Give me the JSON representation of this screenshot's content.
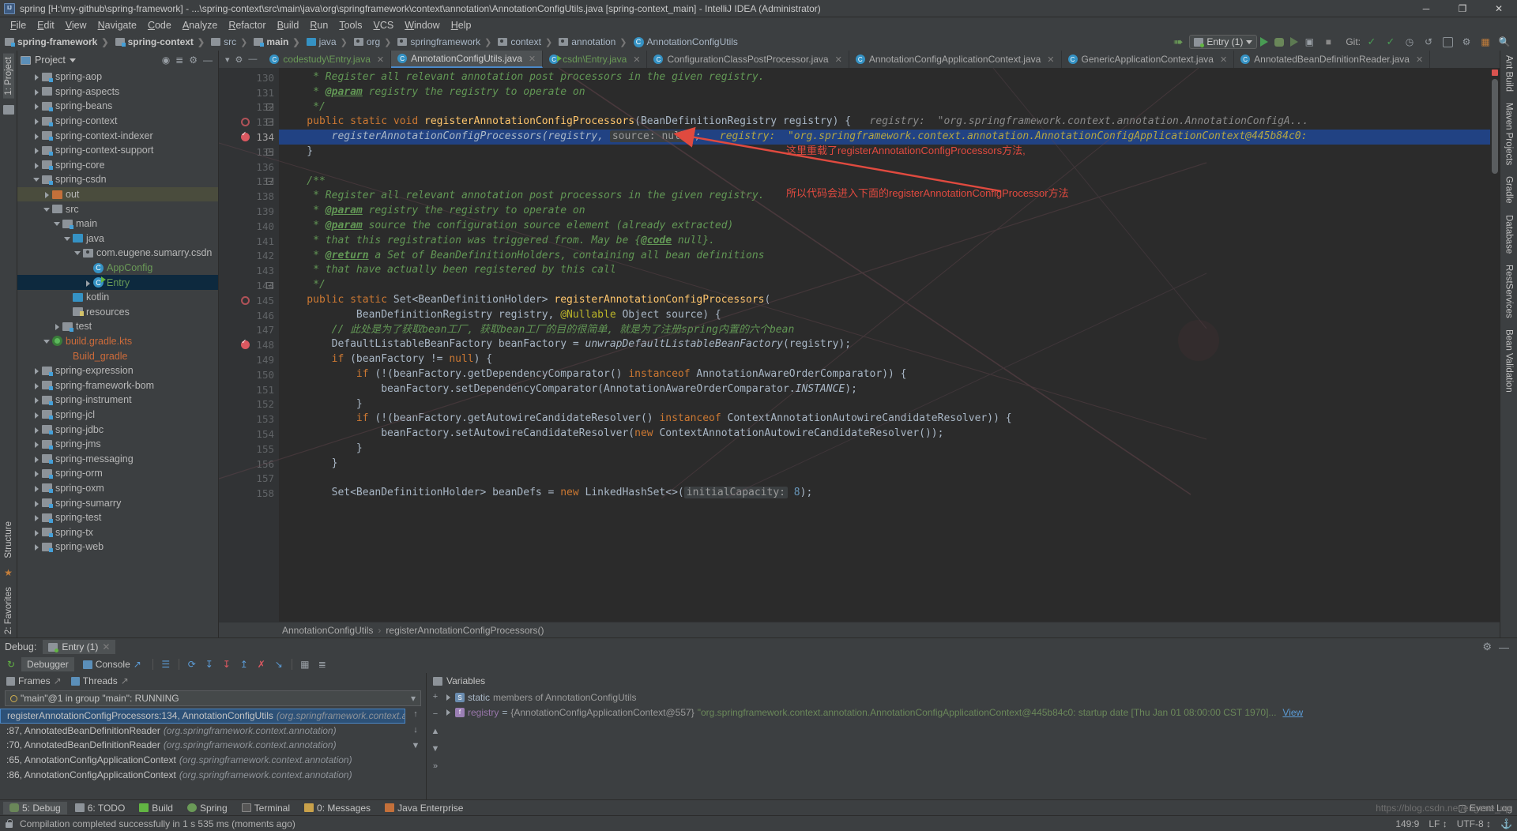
{
  "window": {
    "title": "spring [H:\\my-github\\spring-framework] - ...\\spring-context\\src\\main\\java\\org\\springframework\\context\\annotation\\AnnotationConfigUtils.java [spring-context_main] - IntelliJ IDEA (Administrator)",
    "minimize": "─",
    "maximize": "❐",
    "close": "✕"
  },
  "menu": [
    "File",
    "Edit",
    "View",
    "Navigate",
    "Code",
    "Analyze",
    "Refactor",
    "Build",
    "Run",
    "Tools",
    "VCS",
    "Window",
    "Help"
  ],
  "navbar": {
    "crumbs": [
      {
        "label": "spring-framework",
        "icon": "module-folder-icon",
        "bold": true
      },
      {
        "label": "spring-context",
        "icon": "module-folder-icon",
        "bold": true
      },
      {
        "label": "src",
        "icon": "folder-icon",
        "bold": false
      },
      {
        "label": "main",
        "icon": "module-folder-icon",
        "bold": true
      },
      {
        "label": "java",
        "icon": "source-folder-icon",
        "bold": false
      },
      {
        "label": "org",
        "icon": "package-icon",
        "bold": false
      },
      {
        "label": "springframework",
        "icon": "package-icon",
        "bold": false
      },
      {
        "label": "context",
        "icon": "package-icon",
        "bold": false
      },
      {
        "label": "annotation",
        "icon": "package-icon",
        "bold": false
      },
      {
        "label": "AnnotationConfigUtils",
        "icon": "class-icon",
        "bold": false
      }
    ],
    "run_config": "Entry (1)",
    "git_label": "Git:"
  },
  "project_panel": {
    "title": "Project",
    "tree": [
      {
        "label": "spring-aop",
        "indent": 1,
        "arrow": "right",
        "icon": "module",
        "color": "default"
      },
      {
        "label": "spring-aspects",
        "indent": 1,
        "arrow": "right",
        "icon": "plain",
        "color": "default"
      },
      {
        "label": "spring-beans",
        "indent": 1,
        "arrow": "right",
        "icon": "module",
        "color": "default"
      },
      {
        "label": "spring-context",
        "indent": 1,
        "arrow": "right",
        "icon": "module",
        "color": "default"
      },
      {
        "label": "spring-context-indexer",
        "indent": 1,
        "arrow": "right",
        "icon": "module",
        "color": "default"
      },
      {
        "label": "spring-context-support",
        "indent": 1,
        "arrow": "right",
        "icon": "module",
        "color": "default"
      },
      {
        "label": "spring-core",
        "indent": 1,
        "arrow": "right",
        "icon": "module",
        "color": "default"
      },
      {
        "label": "spring-csdn",
        "indent": 1,
        "arrow": "down",
        "icon": "module",
        "color": "default"
      },
      {
        "label": "out",
        "indent": 2,
        "arrow": "right",
        "icon": "orange",
        "color": "default",
        "row": "sel-green"
      },
      {
        "label": "src",
        "indent": 2,
        "arrow": "down",
        "icon": "plain",
        "color": "default"
      },
      {
        "label": "main",
        "indent": 3,
        "arrow": "down",
        "icon": "module",
        "color": "default"
      },
      {
        "label": "java",
        "indent": 4,
        "arrow": "down",
        "icon": "blue",
        "color": "default"
      },
      {
        "label": "com.eugene.sumarry.csdn",
        "indent": 5,
        "arrow": "down",
        "icon": "package",
        "color": "default"
      },
      {
        "label": "AppConfig",
        "indent": 6,
        "arrow": "none",
        "icon": "class",
        "color": "green"
      },
      {
        "label": "Entry",
        "indent": 6,
        "arrow": "right",
        "icon": "class-run",
        "color": "green",
        "row": "sel-blue"
      },
      {
        "label": "kotlin",
        "indent": 4,
        "arrow": "none",
        "icon": "blue",
        "color": "default"
      },
      {
        "label": "resources",
        "indent": 4,
        "arrow": "none",
        "icon": "res",
        "color": "default"
      },
      {
        "label": "test",
        "indent": 3,
        "arrow": "right",
        "icon": "module",
        "color": "default"
      },
      {
        "label": "build.gradle.kts",
        "indent": 2,
        "arrow": "down",
        "icon": "gradle",
        "color": "orange"
      },
      {
        "label": "Build_gradle",
        "indent": 4,
        "arrow": "none",
        "icon": "none",
        "color": "orange"
      },
      {
        "label": "spring-expression",
        "indent": 1,
        "arrow": "right",
        "icon": "module",
        "color": "default"
      },
      {
        "label": "spring-framework-bom",
        "indent": 1,
        "arrow": "right",
        "icon": "module",
        "color": "default"
      },
      {
        "label": "spring-instrument",
        "indent": 1,
        "arrow": "right",
        "icon": "module",
        "color": "default"
      },
      {
        "label": "spring-jcl",
        "indent": 1,
        "arrow": "right",
        "icon": "module",
        "color": "default"
      },
      {
        "label": "spring-jdbc",
        "indent": 1,
        "arrow": "right",
        "icon": "module",
        "color": "default"
      },
      {
        "label": "spring-jms",
        "indent": 1,
        "arrow": "right",
        "icon": "module",
        "color": "default"
      },
      {
        "label": "spring-messaging",
        "indent": 1,
        "arrow": "right",
        "icon": "module",
        "color": "default"
      },
      {
        "label": "spring-orm",
        "indent": 1,
        "arrow": "right",
        "icon": "module",
        "color": "default"
      },
      {
        "label": "spring-oxm",
        "indent": 1,
        "arrow": "right",
        "icon": "module",
        "color": "default"
      },
      {
        "label": "spring-sumarry",
        "indent": 1,
        "arrow": "right",
        "icon": "module",
        "color": "default"
      },
      {
        "label": "spring-test",
        "indent": 1,
        "arrow": "right",
        "icon": "module",
        "color": "default"
      },
      {
        "label": "spring-tx",
        "indent": 1,
        "arrow": "right",
        "icon": "module",
        "color": "default"
      },
      {
        "label": "spring-web",
        "indent": 1,
        "arrow": "right",
        "icon": "module",
        "color": "default"
      }
    ]
  },
  "left_strip": {
    "project_tab": "1: Project",
    "structure_tab": "Structure",
    "favorites_tab": "2: Favorites"
  },
  "right_strip": [
    "Ant Build",
    "Maven Projects",
    "Gradle",
    "Database",
    "RestServices",
    "Bean Validation"
  ],
  "editor_tabs": [
    {
      "label": "codestudy\\Entry.java",
      "icon": "class-icon",
      "active": false,
      "green": true
    },
    {
      "label": "AnnotationConfigUtils.java",
      "icon": "class-icon",
      "active": true,
      "green": false
    },
    {
      "label": "csdn\\Entry.java",
      "icon": "class-run-icon",
      "active": false,
      "green": true
    },
    {
      "label": "ConfigurationClassPostProcessor.java",
      "icon": "class-icon",
      "active": false,
      "green": false
    },
    {
      "label": "AnnotationConfigApplicationContext.java",
      "icon": "class-icon",
      "active": false,
      "green": false
    },
    {
      "label": "GenericApplicationContext.java",
      "icon": "class-icon",
      "active": false,
      "green": false
    },
    {
      "label": "AnnotatedBeanDefinitionReader.java",
      "icon": "class-icon",
      "active": false,
      "green": false
    }
  ],
  "code": {
    "first_line": 130,
    "current_line": 134,
    "lines": [
      {
        "n": 130,
        "html": "<span class='cm'>     * Register all relevant annotation post processors in the given registry.</span>"
      },
      {
        "n": 131,
        "html": "<span class='cm'>     * </span><span class='cm-tag'>@param</span><span class='cm'> registry the registry to operate on</span>"
      },
      {
        "n": 132,
        "html": "<span class='cm'>     */</span>",
        "fold": true
      },
      {
        "n": 133,
        "html": "<span class='kw'>    public static void </span><span class='fn'>registerAnnotationConfigProcessors</span><span class='plain'>(BeanDefinitionRegistry registry) {</span>",
        "fold": true,
        "bp": "ring",
        "hint": "registry:  \"org.springframework.context.annotation.AnnotationConfigA..."
      },
      {
        "n": 134,
        "html": "<span class='plain italicf'>        registerAnnotationConfigProcessors(registry, </span>",
        "hl": true,
        "bp": "check",
        "param_hint": "source: null",
        "tail": ");",
        "inline": "registry:  \"org.springframework.context.annotation.AnnotationConfigApplicationContext@445b84c0:"
      },
      {
        "n": 135,
        "html": "<span class='plain'>    }</span>",
        "fold": true
      },
      {
        "n": 136,
        "html": ""
      },
      {
        "n": 137,
        "html": "<span class='cm'>    /**</span>",
        "fold": true
      },
      {
        "n": 138,
        "html": "<span class='cm'>     * Register all relevant annotation post processors in the given registry.</span>"
      },
      {
        "n": 139,
        "html": "<span class='cm'>     * </span><span class='cm-tag'>@param</span><span class='cm'> registry the registry to operate on</span>"
      },
      {
        "n": 140,
        "html": "<span class='cm'>     * </span><span class='cm-tag'>@param</span><span class='cm'> source the configuration source element (already extracted)</span>"
      },
      {
        "n": 141,
        "html": "<span class='cm'>     * that this registration was triggered from. May be {</span><span class='cm-tag'>@code</span><span class='cm'> null}.</span>"
      },
      {
        "n": 142,
        "html": "<span class='cm'>     * </span><span class='cm-tag'>@return</span><span class='cm'> a Set of BeanDefinitionHolders, containing all bean definitions</span>"
      },
      {
        "n": 143,
        "html": "<span class='cm'>     * that have actually been registered by this call</span>"
      },
      {
        "n": 144,
        "html": "<span class='cm'>     */</span>",
        "fold": true
      },
      {
        "n": 145,
        "html": "<span class='kw'>    public static </span><span class='plain'>Set&lt;BeanDefinitionHolder&gt; </span><span class='fn'>registerAnnotationConfigProcessors</span><span class='plain'>(</span>",
        "bp": "ring"
      },
      {
        "n": 146,
        "html": "<span class='plain'>            BeanDefinitionRegistry registry, </span><span class='an'>@Nullable </span><span class='plain'>Object source) {</span>"
      },
      {
        "n": 147,
        "html": "<span class='cn-cmt'>        // 此处是为了获取bean工厂, 获取bean工厂的目的很简单, 就是为了注册spring内置的六个bean</span>"
      },
      {
        "n": 148,
        "html": "<span class='plain'>        DefaultListableBeanFactory beanFactory = </span><span class='plain italicf'>unwrapDefaultListableBeanFactory</span><span class='plain'>(registry);</span>",
        "bp": "check"
      },
      {
        "n": 149,
        "html": "<span class='kw'>        if </span><span class='plain'>(beanFactory != </span><span class='kw'>null</span><span class='plain'>) {</span>"
      },
      {
        "n": 150,
        "html": "<span class='kw'>            if </span><span class='plain'>(!(beanFactory.getDependencyComparator() </span><span class='kw'>instanceof </span><span class='plain'>AnnotationAwareOrderComparator)) {</span>"
      },
      {
        "n": 151,
        "html": "<span class='plain'>                beanFactory.setDependencyComparator(AnnotationAwareOrderComparator.</span><span class='plain italicf'>INSTANCE</span><span class='plain'>);</span>"
      },
      {
        "n": 152,
        "html": "<span class='plain'>            }</span>"
      },
      {
        "n": 153,
        "html": "<span class='kw'>            if </span><span class='plain'>(!(beanFactory.getAutowireCandidateResolver() </span><span class='kw'>instanceof </span><span class='plain'>ContextAnnotationAutowireCandidateResolver)) {</span>"
      },
      {
        "n": 154,
        "html": "<span class='plain'>                beanFactory.setAutowireCandidateResolver(</span><span class='kw'>new </span><span class='plain'>ContextAnnotationAutowireCandidateResolver());</span>"
      },
      {
        "n": 155,
        "html": "<span class='plain'>            }</span>"
      },
      {
        "n": 156,
        "html": "<span class='plain'>        }</span>"
      },
      {
        "n": 157,
        "html": ""
      },
      {
        "n": 158,
        "html": "<span class='plain'>        Set&lt;BeanDefinitionHolder&gt; beanDefs = </span><span class='kw'>new </span><span class='plain'>LinkedHashSet&lt;&gt;(</span><span class='hint'>initialCapacity:</span><span class='num'> 8</span><span class='plain'>);</span>"
      }
    ]
  },
  "annotation_note": {
    "line1": "这里重载了registerAnnotationConfigProcessors方法,",
    "line2": "所以代码会进入下面的registerAnnotationConfigProcessor方法",
    "color": "#e04a3f"
  },
  "breadcrumbs": {
    "class": "AnnotationConfigUtils",
    "method": "registerAnnotationConfigProcessors()",
    "sep": "›"
  },
  "debug_panel": {
    "label": "Debug:",
    "session_tab": "Entry (1)",
    "tabs": [
      {
        "label": "Debugger",
        "selected": true
      },
      {
        "label": "Console",
        "selected": false
      }
    ],
    "frames_header": {
      "frames": "Frames",
      "threads": "Threads"
    },
    "thread_selector": "\"main\"@1 in group \"main\": RUNNING",
    "frames": [
      {
        "method": "registerAnnotationConfigProcessors:134, AnnotationConfigUtils",
        "pkg": "(org.springframework.context.annotation)",
        "selected": true
      },
      {
        "method": "<init>:87, AnnotatedBeanDefinitionReader",
        "pkg": "(org.springframework.context.annotation)",
        "selected": false
      },
      {
        "method": "<init>:70, AnnotatedBeanDefinitionReader",
        "pkg": "(org.springframework.context.annotation)",
        "selected": false
      },
      {
        "method": "<init>:65, AnnotationConfigApplicationContext",
        "pkg": "(org.springframework.context.annotation)",
        "selected": false
      },
      {
        "method": "<init>:86, AnnotationConfigApplicationContext",
        "pkg": "(org.springframework.context.annotation)",
        "selected": false
      }
    ],
    "variables_header": "Variables",
    "variables": [
      {
        "kind": "static",
        "name": "static",
        "rest": "members of AnnotationConfigUtils",
        "expand": true
      },
      {
        "kind": "field",
        "name": "registry",
        "eq": "=",
        "type": "{AnnotationConfigApplicationContext@557}",
        "value": "\"org.springframework.context.annotation.AnnotationConfigApplicationContext@445b84c0: startup date [Thu Jan 01 08:00:00 CST 1970]...",
        "more": "View",
        "expand": true
      }
    ]
  },
  "bottom_tabs": [
    {
      "label": "5: Debug",
      "selected": true,
      "icon": "bug"
    },
    {
      "label": "6: TODO",
      "selected": false,
      "icon": "todo"
    },
    {
      "label": "Build",
      "selected": false,
      "icon": "build"
    },
    {
      "label": "Spring",
      "selected": false,
      "icon": "spring"
    },
    {
      "label": "Terminal",
      "selected": false,
      "icon": "terminal"
    },
    {
      "label": "0: Messages",
      "selected": false,
      "icon": "messages"
    },
    {
      "label": "Java Enterprise",
      "selected": false,
      "icon": "java"
    }
  ],
  "bottom_right_tabs": [
    "Event Log"
  ],
  "status_bar": {
    "message": "Compilation completed successfully in 1 s 535 ms (moments ago)",
    "caret": "149:9",
    "line_sep": "LF ↕",
    "encoding": "UTF-8 ↕",
    "indent": "⚓"
  },
  "watermark": "https://blog.csdn.net/eugene_up"
}
